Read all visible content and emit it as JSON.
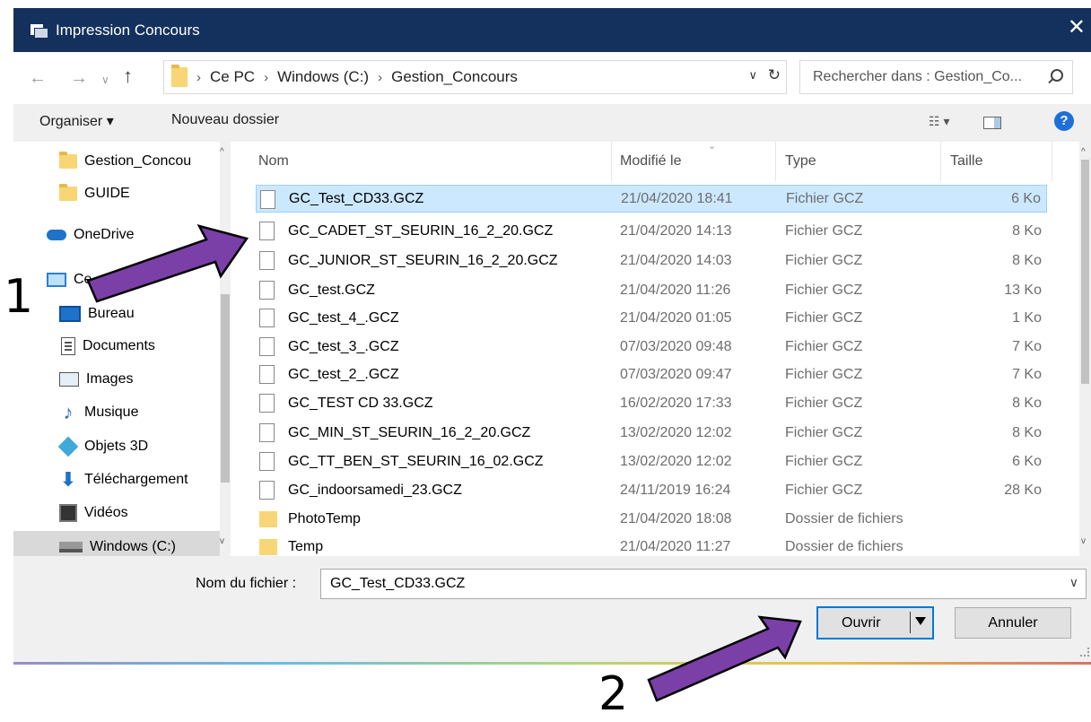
{
  "window": {
    "title": "Impression Concours",
    "close_glyph": "✕"
  },
  "address": {
    "path": [
      "Ce PC",
      "Windows (C:)",
      "Gestion_Concours"
    ],
    "search_placeholder": "Rechercher dans : Gestion_Co..."
  },
  "toolbar": {
    "organiser": "Organiser ▾",
    "nouveau_dossier": "Nouveau dossier"
  },
  "sidebar": {
    "items": [
      {
        "label": "Gestion_Concou",
        "icon": "folder-icon"
      },
      {
        "label": "GUIDE",
        "icon": "folder-icon"
      },
      {
        "label": "OneDrive",
        "icon": "onedrive-icon"
      },
      {
        "label": "Ce",
        "icon": "pc-icon"
      },
      {
        "label": "Bureau",
        "icon": "desktop-icon"
      },
      {
        "label": "Documents",
        "icon": "documents-icon"
      },
      {
        "label": "Images",
        "icon": "images-icon"
      },
      {
        "label": "Musique",
        "icon": "music-icon"
      },
      {
        "label": "Objets 3D",
        "icon": "objects3d-icon"
      },
      {
        "label": "Téléchargement",
        "icon": "download-icon"
      },
      {
        "label": "Vidéos",
        "icon": "video-icon"
      },
      {
        "label": "Windows (C:)",
        "icon": "drive-icon"
      }
    ]
  },
  "columns": {
    "name": "Nom",
    "modified": "Modifié le",
    "type": "Type",
    "size": "Taille"
  },
  "files": [
    {
      "name": "GC_Test_CD33.GCZ",
      "date": "21/04/2020 18:41",
      "type": "Fichier GCZ",
      "size": "6 Ko"
    },
    {
      "name": "GC_CADET_ST_SEURIN_16_2_20.GCZ",
      "date": "21/04/2020 14:13",
      "type": "Fichier GCZ",
      "size": "8 Ko"
    },
    {
      "name": "GC_JUNIOR_ST_SEURIN_16_2_20.GCZ",
      "date": "21/04/2020 14:03",
      "type": "Fichier GCZ",
      "size": "8 Ko"
    },
    {
      "name": "GC_test.GCZ",
      "date": "21/04/2020 11:26",
      "type": "Fichier GCZ",
      "size": "13 Ko"
    },
    {
      "name": "GC_test_4_.GCZ",
      "date": "21/04/2020 01:05",
      "type": "Fichier GCZ",
      "size": "1 Ko"
    },
    {
      "name": "GC_test_3_.GCZ",
      "date": "07/03/2020 09:48",
      "type": "Fichier GCZ",
      "size": "7 Ko"
    },
    {
      "name": "GC_test_2_.GCZ",
      "date": "07/03/2020 09:47",
      "type": "Fichier GCZ",
      "size": "7 Ko"
    },
    {
      "name": "GC_TEST CD 33.GCZ",
      "date": "16/02/2020 17:33",
      "type": "Fichier GCZ",
      "size": "8 Ko"
    },
    {
      "name": "GC_MIN_ST_SEURIN_16_2_20.GCZ",
      "date": "13/02/2020 12:02",
      "type": "Fichier GCZ",
      "size": "8 Ko"
    },
    {
      "name": "GC_TT_BEN_ST_SEURIN_16_02.GCZ",
      "date": "13/02/2020 12:02",
      "type": "Fichier GCZ",
      "size": "6 Ko"
    },
    {
      "name": "GC_indoorsamedi_23.GCZ",
      "date": "24/11/2019 16:24",
      "type": "Fichier GCZ",
      "size": "28 Ko"
    },
    {
      "name": "PhotoTemp",
      "date": "21/04/2020 18:08",
      "type": "Dossier de fichiers",
      "size": ""
    },
    {
      "name": "Temp",
      "date": "21/04/2020 11:27",
      "type": "Dossier de fichiers",
      "size": ""
    }
  ],
  "footer": {
    "filename_label": "Nom du fichier :",
    "filename_value": "GC_Test_CD33.GCZ",
    "open_label": "Ouvrir",
    "cancel_label": "Annuler"
  },
  "annotations": {
    "step1": "1",
    "step2": "2",
    "arrow_color": "#7b3fa8"
  },
  "colors": {
    "titlebar": "#13315c",
    "selection": "#cce8ff",
    "accent": "#0078d7"
  }
}
